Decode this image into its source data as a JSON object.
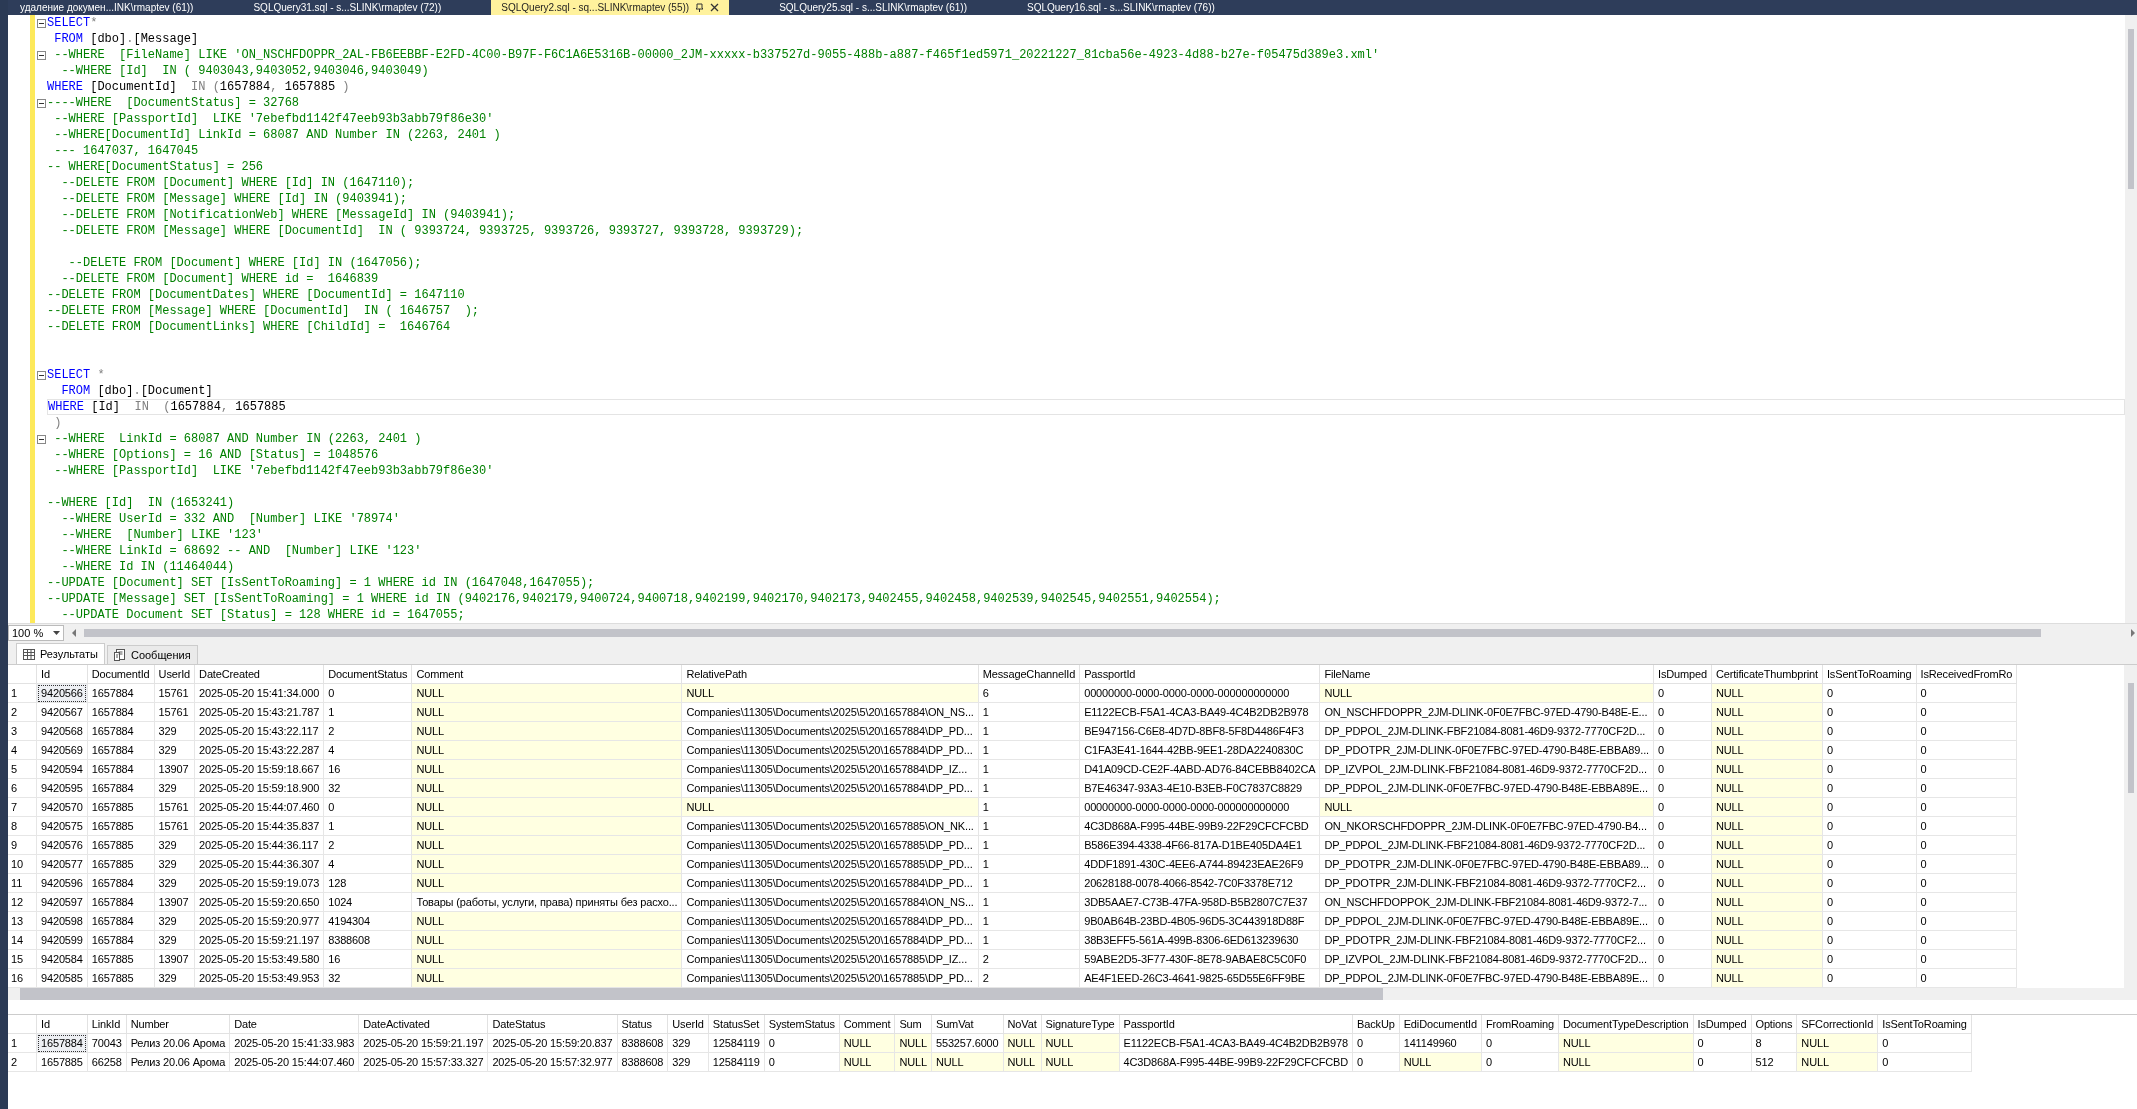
{
  "document_tabs": [
    {
      "title": "удаление докумен...INK\\rmaptev (61))",
      "selected": false
    },
    {
      "title": "SQLQuery31.sql - s...SLINK\\rmaptev (72))",
      "selected": false
    },
    {
      "title": "SQLQuery2.sql - sq...SLINK\\rmaptev (55))",
      "selected": true
    },
    {
      "title": "SQLQuery25.sql - s...SLINK\\rmaptev (61))",
      "selected": false
    },
    {
      "title": "SQLQuery16.sql - s...SLINK\\rmaptev (76))",
      "selected": false
    }
  ],
  "editor": {
    "lines": [
      {
        "fold": true,
        "current": false,
        "segments": [
          {
            "kind": "keyword",
            "text": "SELECT"
          },
          {
            "kind": "operator",
            "text": "*"
          }
        ]
      },
      {
        "fold": false,
        "current": false,
        "segments": [
          {
            "kind": "keyword",
            "text": " FROM"
          },
          {
            "kind": "plain",
            "text": " [dbo]"
          },
          {
            "kind": "operator",
            "text": "."
          },
          {
            "kind": "plain",
            "text": "[Message]"
          }
        ]
      },
      {
        "fold": true,
        "current": false,
        "segments": [
          {
            "kind": "comment",
            "text": " --WHERE  [FileName] LIKE 'ON_NSCHFDOPPR_2AL-FB6EEBBF-E2FD-4C00-B97F-F6C1A6E5316B-00000_2JM-xxxxx-b337527d-9055-488b-a887-f465f1ed5971_20221227_81cba56e-4923-4d88-b27e-f05475d389e3.xml'"
          }
        ]
      },
      {
        "fold": false,
        "current": false,
        "segments": [
          {
            "kind": "comment",
            "text": "  --WHERE [Id]  IN ( 9403043,9403052,9403046,9403049)"
          }
        ]
      },
      {
        "fold": false,
        "current": false,
        "segments": [
          {
            "kind": "keyword",
            "text": "WHERE"
          },
          {
            "kind": "plain",
            "text": " [DocumentId]  "
          },
          {
            "kind": "operator",
            "text": "IN ("
          },
          {
            "kind": "plain",
            "text": "1657884"
          },
          {
            "kind": "operator",
            "text": ","
          },
          {
            "kind": "plain",
            "text": " 1657885 "
          },
          {
            "kind": "operator",
            "text": ")"
          }
        ]
      },
      {
        "fold": true,
        "current": false,
        "segments": [
          {
            "kind": "comment",
            "text": "----WHERE  [DocumentStatus] = 32768"
          }
        ]
      },
      {
        "fold": false,
        "current": false,
        "segments": [
          {
            "kind": "comment",
            "text": " --WHERE [PassportId]  LIKE '7ebefbd1142f47eeb93b3abb79f86e30'"
          }
        ]
      },
      {
        "fold": false,
        "current": false,
        "segments": [
          {
            "kind": "comment",
            "text": " --WHERE[DocumentId] LinkId = 68087 AND Number IN (2263, 2401 )"
          }
        ]
      },
      {
        "fold": false,
        "current": false,
        "segments": [
          {
            "kind": "comment",
            "text": " --- 1647037, 1647045"
          }
        ]
      },
      {
        "fold": false,
        "current": false,
        "segments": [
          {
            "kind": "comment",
            "text": "-- WHERE[DocumentStatus] = 256"
          }
        ]
      },
      {
        "fold": false,
        "current": false,
        "segments": [
          {
            "kind": "comment",
            "text": "  --DELETE FROM [Document] WHERE [Id] IN (1647110);"
          }
        ]
      },
      {
        "fold": false,
        "current": false,
        "segments": [
          {
            "kind": "comment",
            "text": "  --DELETE FROM [Message] WHERE [Id] IN (9403941);"
          }
        ]
      },
      {
        "fold": false,
        "current": false,
        "segments": [
          {
            "kind": "comment",
            "text": "  --DELETE FROM [NotificationWeb] WHERE [MessageId] IN (9403941);"
          }
        ]
      },
      {
        "fold": false,
        "current": false,
        "segments": [
          {
            "kind": "comment",
            "text": "  --DELETE FROM [Message] WHERE [DocumentId]  IN ( 9393724, 9393725, 9393726, 9393727, 9393728, 9393729);"
          }
        ]
      },
      {
        "fold": false,
        "current": false
      },
      {
        "fold": false,
        "current": false,
        "segments": [
          {
            "kind": "comment",
            "text": "   --DELETE FROM [Document] WHERE [Id] IN (1647056);"
          }
        ]
      },
      {
        "fold": false,
        "current": false,
        "segments": [
          {
            "kind": "comment",
            "text": "  --DELETE FROM [Document] WHERE id =  1646839"
          }
        ]
      },
      {
        "fold": false,
        "current": false,
        "segments": [
          {
            "kind": "comment",
            "text": "--DELETE FROM [DocumentDates] WHERE [DocumentId] = 1647110"
          }
        ]
      },
      {
        "fold": false,
        "current": false,
        "segments": [
          {
            "kind": "comment",
            "text": "--DELETE FROM [Message] WHERE [DocumentId]  IN ( 1646757  );"
          }
        ]
      },
      {
        "fold": false,
        "current": false,
        "segments": [
          {
            "kind": "comment",
            "text": "--DELETE FROM [DocumentLinks] WHERE [ChildId] =  1646764"
          }
        ]
      },
      {
        "fold": false,
        "current": false
      },
      {
        "fold": false,
        "current": false
      },
      {
        "fold": true,
        "current": false,
        "segments": [
          {
            "kind": "keyword",
            "text": "SELECT"
          },
          {
            "kind": "operator",
            "text": " *"
          }
        ]
      },
      {
        "fold": false,
        "current": false,
        "segments": [
          {
            "kind": "keyword",
            "text": "  FROM"
          },
          {
            "kind": "plain",
            "text": " [dbo]"
          },
          {
            "kind": "operator",
            "text": "."
          },
          {
            "kind": "plain",
            "text": "[Document]"
          }
        ]
      },
      {
        "fold": false,
        "current": true,
        "segments": [
          {
            "kind": "keyword",
            "text": "WHERE"
          },
          {
            "kind": "plain",
            "text": " [Id]  "
          },
          {
            "kind": "operator",
            "text": "IN  ("
          },
          {
            "kind": "plain",
            "text": "1657884"
          },
          {
            "kind": "operator",
            "text": ","
          },
          {
            "kind": "plain",
            "text": " 1657885"
          }
        ]
      },
      {
        "fold": false,
        "current": false,
        "segments": [
          {
            "kind": "operator",
            "text": " )"
          }
        ]
      },
      {
        "fold": true,
        "current": false,
        "segments": [
          {
            "kind": "comment",
            "text": " --WHERE  LinkId = 68087 AND Number IN (2263, 2401 )"
          }
        ]
      },
      {
        "fold": false,
        "current": false,
        "segments": [
          {
            "kind": "comment",
            "text": " --WHERE [Options] = 16 AND [Status] = 1048576"
          }
        ]
      },
      {
        "fold": false,
        "current": false,
        "segments": [
          {
            "kind": "comment",
            "text": " --WHERE [PassportId]  LIKE '7ebefbd1142f47eeb93b3abb79f86e30'"
          }
        ]
      },
      {
        "fold": false,
        "current": false
      },
      {
        "fold": false,
        "current": false,
        "segments": [
          {
            "kind": "comment",
            "text": "--WHERE [Id]  IN (1653241)"
          }
        ]
      },
      {
        "fold": false,
        "current": false,
        "segments": [
          {
            "kind": "comment",
            "text": "  --WHERE UserId = 332 AND  [Number] LIKE '78974'"
          }
        ]
      },
      {
        "fold": false,
        "current": false,
        "segments": [
          {
            "kind": "comment",
            "text": "  --WHERE  [Number] LIKE '123'"
          }
        ]
      },
      {
        "fold": false,
        "current": false,
        "segments": [
          {
            "kind": "comment",
            "text": "  --WHERE LinkId = 68692 -- AND  [Number] LIKE '123'"
          }
        ]
      },
      {
        "fold": false,
        "current": false,
        "segments": [
          {
            "kind": "comment",
            "text": "  --WHERE Id IN (11464044)"
          }
        ]
      },
      {
        "fold": false,
        "current": false,
        "segments": [
          {
            "kind": "comment",
            "text": "--UPDATE [Document] SET [IsSentToRoaming] = 1 WHERE id IN (1647048,1647055);"
          }
        ]
      },
      {
        "fold": false,
        "current": false,
        "segments": [
          {
            "kind": "comment",
            "text": "--UPDATE [Message] SET [IsSentToRoaming] = 1 WHERE id IN (9402176,9402179,9400724,9400718,9402199,9402170,9402173,9402455,9402458,9402539,9402545,9402551,9402554);"
          }
        ]
      },
      {
        "fold": false,
        "current": false,
        "segments": [
          {
            "kind": "comment",
            "text": "  --UPDATE Document SET [Status] = 128 WHERE id = 1647055;"
          }
        ]
      }
    ]
  },
  "zoom": {
    "value": "100 %"
  },
  "results_tabs": [
    {
      "label": "Результаты",
      "kind": "grid",
      "selected": true
    },
    {
      "label": "Сообщения",
      "kind": "messages",
      "selected": false
    }
  ],
  "result_grids": [
    {
      "columns": [
        "Id",
        "DocumentId",
        "UserId",
        "DateCreated",
        "DocumentStatus",
        "Comment",
        "RelativePath",
        "MessageChannelId",
        "PassportId",
        "FileName",
        "IsDumped",
        "CertificateThumbprint",
        "IsSentToRoaming",
        "IsReceivedFromRo"
      ],
      "rows": [
        {
          "number": "1",
          "cells": [
            {
              "text": "9420566",
              "focused": true
            },
            "1657884",
            "15761",
            "2025-05-20 15:41:34.000",
            "0",
            {
              "text": "NULL",
              "null": true
            },
            {
              "text": "NULL",
              "null": true
            },
            "6",
            "00000000-0000-0000-0000-000000000000",
            {
              "text": "NULL",
              "null": true
            },
            "0",
            {
              "text": "NULL",
              "null": true
            },
            "0",
            "0"
          ]
        },
        {
          "number": "2",
          "cells": [
            "9420567",
            "1657884",
            "15761",
            "2025-05-20 15:43:21.787",
            "1",
            {
              "text": "NULL",
              "null": true
            },
            "Companies\\11305\\Documents\\2025\\5\\20\\1657884\\ON_NS...",
            "1",
            "E1122ECB-F5A1-4CA3-BA49-4C4B2DB2B978",
            "ON_NSCHFDOPPR_2JM-DLINK-0F0E7FBC-97ED-4790-B48E-E...",
            "0",
            {
              "text": "NULL",
              "null": true
            },
            "0",
            "0"
          ]
        },
        {
          "number": "3",
          "cells": [
            "9420568",
            "1657884",
            "329",
            "2025-05-20 15:43:22.117",
            "2",
            {
              "text": "NULL",
              "null": true
            },
            "Companies\\11305\\Documents\\2025\\5\\20\\1657884\\DP_PD...",
            "1",
            "BE947156-C6E8-4D7D-8BF8-5F8D4486F4F3",
            "DP_PDPOL_2JM-DLINK-FBF21084-8081-46D9-9372-7770CF2D...",
            "0",
            {
              "text": "NULL",
              "null": true
            },
            "0",
            "0"
          ]
        },
        {
          "number": "4",
          "cells": [
            "9420569",
            "1657884",
            "329",
            "2025-05-20 15:43:22.287",
            "4",
            {
              "text": "NULL",
              "null": true
            },
            "Companies\\11305\\Documents\\2025\\5\\20\\1657884\\DP_PD...",
            "1",
            "C1FA3E41-1644-42BB-9EE1-28DA2240830C",
            "DP_PDOTPR_2JM-DLINK-0F0E7FBC-97ED-4790-B48E-EBBA89...",
            "0",
            {
              "text": "NULL",
              "null": true
            },
            "0",
            "0"
          ]
        },
        {
          "number": "5",
          "cells": [
            "9420594",
            "1657884",
            "13907",
            "2025-05-20 15:59:18.667",
            "16",
            {
              "text": "NULL",
              "null": true
            },
            "Companies\\11305\\Documents\\2025\\5\\20\\1657884\\DP_IZ...",
            "1",
            "D41A09CD-CE2F-4ABD-AD76-84CEBB8402CA",
            "DP_IZVPOL_2JM-DLINK-FBF21084-8081-46D9-9372-7770CF2D...",
            "0",
            {
              "text": "NULL",
              "null": true
            },
            "0",
            "0"
          ]
        },
        {
          "number": "6",
          "cells": [
            "9420595",
            "1657884",
            "329",
            "2025-05-20 15:59:18.900",
            "32",
            {
              "text": "NULL",
              "null": true
            },
            "Companies\\11305\\Documents\\2025\\5\\20\\1657884\\DP_PD...",
            "1",
            "B7E46347-93A3-4E10-B3EB-F0C7837C8829",
            "DP_PDPOL_2JM-DLINK-0F0E7FBC-97ED-4790-B48E-EBBA89E...",
            "0",
            {
              "text": "NULL",
              "null": true
            },
            "0",
            "0"
          ]
        },
        {
          "number": "7",
          "cells": [
            "9420570",
            "1657885",
            "15761",
            "2025-05-20 15:44:07.460",
            "0",
            {
              "text": "NULL",
              "null": true
            },
            {
              "text": "NULL",
              "null": true
            },
            "1",
            "00000000-0000-0000-0000-000000000000",
            {
              "text": "NULL",
              "null": true
            },
            "0",
            {
              "text": "NULL",
              "null": true
            },
            "0",
            "0"
          ]
        },
        {
          "number": "8",
          "cells": [
            "9420575",
            "1657885",
            "15761",
            "2025-05-20 15:44:35.837",
            "1",
            {
              "text": "NULL",
              "null": true
            },
            "Companies\\11305\\Documents\\2025\\5\\20\\1657885\\ON_NK...",
            "1",
            "4C3D868A-F995-44BE-99B9-22F29CFCFCBD",
            "ON_NKORSCHFDOPPR_2JM-DLINK-0F0E7FBC-97ED-4790-B4...",
            "0",
            {
              "text": "NULL",
              "null": true
            },
            "0",
            "0"
          ]
        },
        {
          "number": "9",
          "cells": [
            "9420576",
            "1657885",
            "329",
            "2025-05-20 15:44:36.117",
            "2",
            {
              "text": "NULL",
              "null": true
            },
            "Companies\\11305\\Documents\\2025\\5\\20\\1657885\\DP_PD...",
            "1",
            "B586E394-4338-4F66-817A-D1BE405DA4E1",
            "DP_PDPOL_2JM-DLINK-FBF21084-8081-46D9-9372-7770CF2D...",
            "0",
            {
              "text": "NULL",
              "null": true
            },
            "0",
            "0"
          ]
        },
        {
          "number": "10",
          "cells": [
            "9420577",
            "1657885",
            "329",
            "2025-05-20 15:44:36.307",
            "4",
            {
              "text": "NULL",
              "null": true
            },
            "Companies\\11305\\Documents\\2025\\5\\20\\1657885\\DP_PD...",
            "1",
            "4DDF1891-430C-4EE6-A744-89423EAE26F9",
            "DP_PDOTPR_2JM-DLINK-0F0E7FBC-97ED-4790-B48E-EBBA89...",
            "0",
            {
              "text": "NULL",
              "null": true
            },
            "0",
            "0"
          ]
        },
        {
          "number": "11",
          "cells": [
            "9420596",
            "1657884",
            "329",
            "2025-05-20 15:59:19.073",
            "128",
            {
              "text": "NULL",
              "null": true
            },
            "Companies\\11305\\Documents\\2025\\5\\20\\1657884\\DP_PD...",
            "1",
            "20628188-0078-4066-8542-7C0F3378E712",
            "DP_PDOTPR_2JM-DLINK-FBF21084-8081-46D9-9372-7770CF2...",
            "0",
            {
              "text": "NULL",
              "null": true
            },
            "0",
            "0"
          ]
        },
        {
          "number": "12",
          "cells": [
            "9420597",
            "1657884",
            "13907",
            "2025-05-20 15:59:20.650",
            "1024",
            "Товары (работы, услуги, права) приняты без расхо...",
            "Companies\\11305\\Documents\\2025\\5\\20\\1657884\\ON_NS...",
            "1",
            "3DB5AAE7-C73B-47FA-958D-B5B2807C7E37",
            "ON_NSCHFDOPPOK_2JM-DLINK-FBF21084-8081-46D9-9372-7...",
            "0",
            {
              "text": "NULL",
              "null": true
            },
            "0",
            "0"
          ]
        },
        {
          "number": "13",
          "cells": [
            "9420598",
            "1657884",
            "329",
            "2025-05-20 15:59:20.977",
            "4194304",
            {
              "text": "NULL",
              "null": true
            },
            "Companies\\11305\\Documents\\2025\\5\\20\\1657884\\DP_PD...",
            "1",
            "9B0AB64B-23BD-4B05-96D5-3C443918D88F",
            "DP_PDPOL_2JM-DLINK-0F0E7FBC-97ED-4790-B48E-EBBA89E...",
            "0",
            {
              "text": "NULL",
              "null": true
            },
            "0",
            "0"
          ]
        },
        {
          "number": "14",
          "cells": [
            "9420599",
            "1657884",
            "329",
            "2025-05-20 15:59:21.197",
            "8388608",
            {
              "text": "NULL",
              "null": true
            },
            "Companies\\11305\\Documents\\2025\\5\\20\\1657884\\DP_PD...",
            "1",
            "38B3EFF5-561A-499B-8306-6ED613239630",
            "DP_PDOTPR_2JM-DLINK-FBF21084-8081-46D9-9372-7770CF2...",
            "0",
            {
              "text": "NULL",
              "null": true
            },
            "0",
            "0"
          ]
        },
        {
          "number": "15",
          "cells": [
            "9420584",
            "1657885",
            "13907",
            "2025-05-20 15:53:49.580",
            "16",
            {
              "text": "NULL",
              "null": true
            },
            "Companies\\11305\\Documents\\2025\\5\\20\\1657885\\DP_IZ...",
            "2",
            "59ABE2D5-3F77-430F-8E78-9ABAE8C5C0F0",
            "DP_IZVPOL_2JM-DLINK-FBF21084-8081-46D9-9372-7770CF2D...",
            "0",
            {
              "text": "NULL",
              "null": true
            },
            "0",
            "0"
          ]
        },
        {
          "number": "16",
          "cells": [
            "9420585",
            "1657885",
            "329",
            "2025-05-20 15:53:49.953",
            "32",
            {
              "text": "NULL",
              "null": true
            },
            "Companies\\11305\\Documents\\2025\\5\\20\\1657885\\DP_PD...",
            "2",
            "AE4F1EED-26C3-4641-9825-65D55E6FF9BE",
            "DP_PDPOL_2JM-DLINK-0F0E7FBC-97ED-4790-B48E-EBBA89E...",
            "0",
            {
              "text": "NULL",
              "null": true
            },
            "0",
            "0"
          ]
        }
      ]
    },
    {
      "columns": [
        "Id",
        "LinkId",
        "Number",
        "Date",
        "DateActivated",
        "DateStatus",
        "Status",
        "UserId",
        "StatusSet",
        "SystemStatus",
        "Comment",
        "Sum",
        "SumVat",
        "NoVat",
        "SignatureType",
        "PassportId",
        "BackUp",
        "EdiDocumentId",
        "FromRoaming",
        "DocumentTypeDescription",
        "IsDumped",
        "Options",
        "SFCorrectionId",
        "IsSentToRoaming"
      ],
      "rows": [
        {
          "number": "1",
          "cells": [
            {
              "text": "1657884",
              "focused": true
            },
            "70043",
            "Релиз 20.06 Арома",
            "2025-05-20 15:41:33.983",
            "2025-05-20 15:59:21.197",
            "2025-05-20 15:59:20.837",
            "8388608",
            "329",
            "12584119",
            "0",
            {
              "text": "NULL",
              "null": true
            },
            {
              "text": "NULL",
              "null": true
            },
            "553257.6000",
            {
              "text": "NULL",
              "null": true
            },
            {
              "text": "NULL",
              "null": true
            },
            "E1122ECB-F5A1-4CA3-BA49-4C4B2DB2B978",
            "0",
            "141149960",
            "0",
            {
              "text": "NULL",
              "null": true
            },
            "0",
            "8",
            {
              "text": "NULL",
              "null": true
            },
            "0"
          ]
        },
        {
          "number": "2",
          "cells": [
            "1657885",
            "66258",
            "Релиз 20.06 Арома",
            "2025-05-20 15:44:07.460",
            "2025-05-20 15:57:33.327",
            "2025-05-20 15:57:32.977",
            "8388608",
            "329",
            "12584119",
            "0",
            {
              "text": "NULL",
              "null": true
            },
            {
              "text": "NULL",
              "null": true
            },
            {
              "text": "NULL",
              "null": true
            },
            {
              "text": "NULL",
              "null": true
            },
            {
              "text": "NULL",
              "null": true
            },
            "4C3D868A-F995-44BE-99B9-22F29CFCFCBD",
            "0",
            {
              "text": "NULL",
              "null": true
            },
            "0",
            {
              "text": "NULL",
              "null": true
            },
            "0",
            "512",
            {
              "text": "NULL",
              "null": true
            },
            "0"
          ]
        }
      ]
    }
  ]
}
